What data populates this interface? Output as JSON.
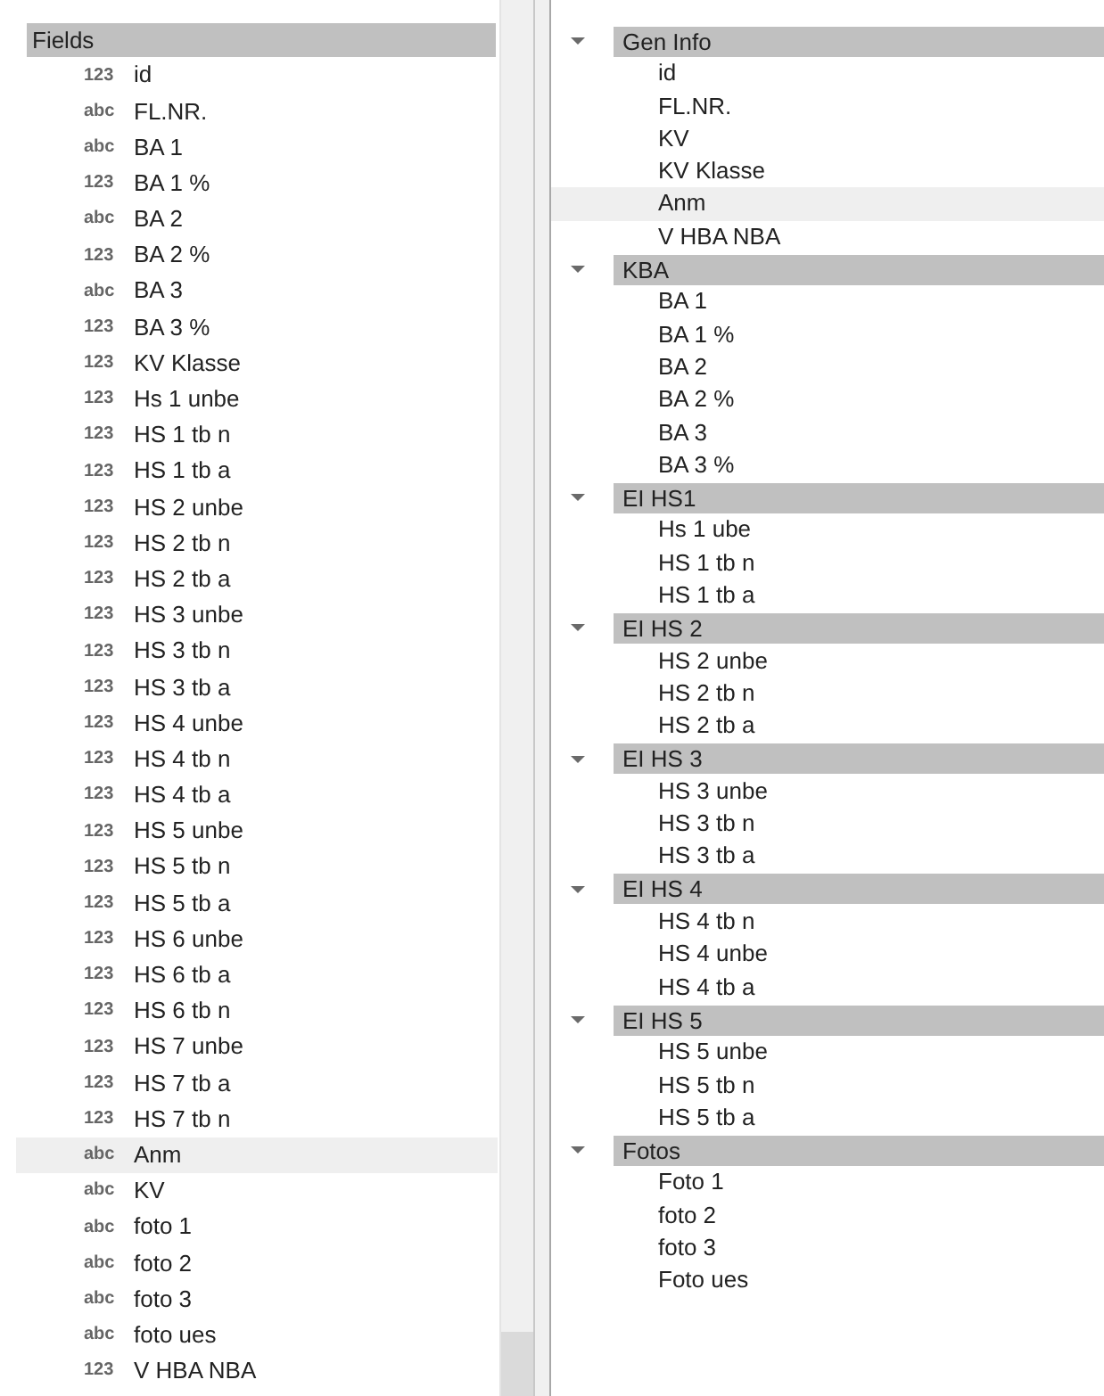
{
  "fields_panel": {
    "header": "Fields",
    "items": [
      {
        "type": "123",
        "label": "id",
        "selected": false
      },
      {
        "type": "abc",
        "label": "FL.NR.",
        "selected": false
      },
      {
        "type": "abc",
        "label": "BA 1",
        "selected": false
      },
      {
        "type": "123",
        "label": "BA 1 %",
        "selected": false
      },
      {
        "type": "abc",
        "label": "BA 2",
        "selected": false
      },
      {
        "type": "123",
        "label": "BA 2 %",
        "selected": false
      },
      {
        "type": "abc",
        "label": "BA 3",
        "selected": false
      },
      {
        "type": "123",
        "label": "BA 3 %",
        "selected": false
      },
      {
        "type": "123",
        "label": "KV Klasse",
        "selected": false
      },
      {
        "type": "123",
        "label": "Hs 1 unbe",
        "selected": false
      },
      {
        "type": "123",
        "label": "HS 1 tb n",
        "selected": false
      },
      {
        "type": "123",
        "label": "HS 1 tb a",
        "selected": false
      },
      {
        "type": "123",
        "label": "HS 2 unbe",
        "selected": false
      },
      {
        "type": "123",
        "label": "HS 2 tb n",
        "selected": false
      },
      {
        "type": "123",
        "label": "HS 2 tb a",
        "selected": false
      },
      {
        "type": "123",
        "label": "HS 3 unbe",
        "selected": false
      },
      {
        "type": "123",
        "label": "HS 3 tb n",
        "selected": false
      },
      {
        "type": "123",
        "label": "HS 3 tb a",
        "selected": false
      },
      {
        "type": "123",
        "label": "HS 4 unbe",
        "selected": false
      },
      {
        "type": "123",
        "label": "HS 4 tb n",
        "selected": false
      },
      {
        "type": "123",
        "label": "HS 4 tb a",
        "selected": false
      },
      {
        "type": "123",
        "label": "HS 5 unbe",
        "selected": false
      },
      {
        "type": "123",
        "label": "HS 5 tb n",
        "selected": false
      },
      {
        "type": "123",
        "label": "HS 5 tb a",
        "selected": false
      },
      {
        "type": "123",
        "label": "HS 6 unbe",
        "selected": false
      },
      {
        "type": "123",
        "label": "HS 6 tb a",
        "selected": false
      },
      {
        "type": "123",
        "label": "HS 6 tb n",
        "selected": false
      },
      {
        "type": "123",
        "label": "HS 7 unbe",
        "selected": false
      },
      {
        "type": "123",
        "label": "HS 7 tb a",
        "selected": false
      },
      {
        "type": "123",
        "label": "HS 7 tb n",
        "selected": false
      },
      {
        "type": "abc",
        "label": "Anm",
        "selected": true
      },
      {
        "type": "abc",
        "label": "KV",
        "selected": false
      },
      {
        "type": "abc",
        "label": "foto 1",
        "selected": false
      },
      {
        "type": "abc",
        "label": "foto 2",
        "selected": false
      },
      {
        "type": "abc",
        "label": "foto 3",
        "selected": false
      },
      {
        "type": "abc",
        "label": "foto ues",
        "selected": false
      },
      {
        "type": "123",
        "label": "V HBA NBA",
        "selected": false
      }
    ]
  },
  "groups_panel": {
    "groups": [
      {
        "label": "Gen Info",
        "expanded": true,
        "children": [
          {
            "label": "id",
            "selected": false
          },
          {
            "label": "FL.NR.",
            "selected": false
          },
          {
            "label": "KV",
            "selected": false
          },
          {
            "label": "KV Klasse",
            "selected": false
          },
          {
            "label": "Anm",
            "selected": true
          },
          {
            "label": "V HBA NBA",
            "selected": false
          }
        ]
      },
      {
        "label": "KBA",
        "expanded": true,
        "children": [
          {
            "label": "BA 1",
            "selected": false
          },
          {
            "label": "BA 1 %",
            "selected": false
          },
          {
            "label": "BA 2",
            "selected": false
          },
          {
            "label": "BA 2 %",
            "selected": false
          },
          {
            "label": "BA 3",
            "selected": false
          },
          {
            "label": "BA 3 %",
            "selected": false
          }
        ]
      },
      {
        "label": "EI HS1",
        "expanded": true,
        "children": [
          {
            "label": "Hs 1 ube",
            "selected": false
          },
          {
            "label": "HS 1 tb n",
            "selected": false
          },
          {
            "label": "HS 1 tb a",
            "selected": false
          }
        ]
      },
      {
        "label": "EI HS 2",
        "expanded": true,
        "children": [
          {
            "label": "HS 2 unbe",
            "selected": false
          },
          {
            "label": "HS 2 tb n",
            "selected": false
          },
          {
            "label": "HS 2 tb a",
            "selected": false
          }
        ]
      },
      {
        "label": "EI HS 3",
        "expanded": true,
        "children": [
          {
            "label": "HS 3 unbe",
            "selected": false
          },
          {
            "label": "HS 3 tb n",
            "selected": false
          },
          {
            "label": "HS 3 tb a",
            "selected": false
          }
        ]
      },
      {
        "label": "EI HS 4",
        "expanded": true,
        "children": [
          {
            "label": "HS 4 tb n",
            "selected": false
          },
          {
            "label": "HS 4 unbe",
            "selected": false
          },
          {
            "label": "HS 4 tb a",
            "selected": false
          }
        ]
      },
      {
        "label": "EI HS 5",
        "expanded": true,
        "children": [
          {
            "label": "HS 5 unbe",
            "selected": false
          },
          {
            "label": "HS 5 tb n",
            "selected": false
          },
          {
            "label": "HS 5 tb a",
            "selected": false
          }
        ]
      },
      {
        "label": "Fotos",
        "expanded": true,
        "children": [
          {
            "label": "Foto 1",
            "selected": false
          },
          {
            "label": "foto 2",
            "selected": false
          },
          {
            "label": "foto 3",
            "selected": false
          },
          {
            "label": "Foto ues",
            "selected": false
          }
        ]
      }
    ]
  }
}
